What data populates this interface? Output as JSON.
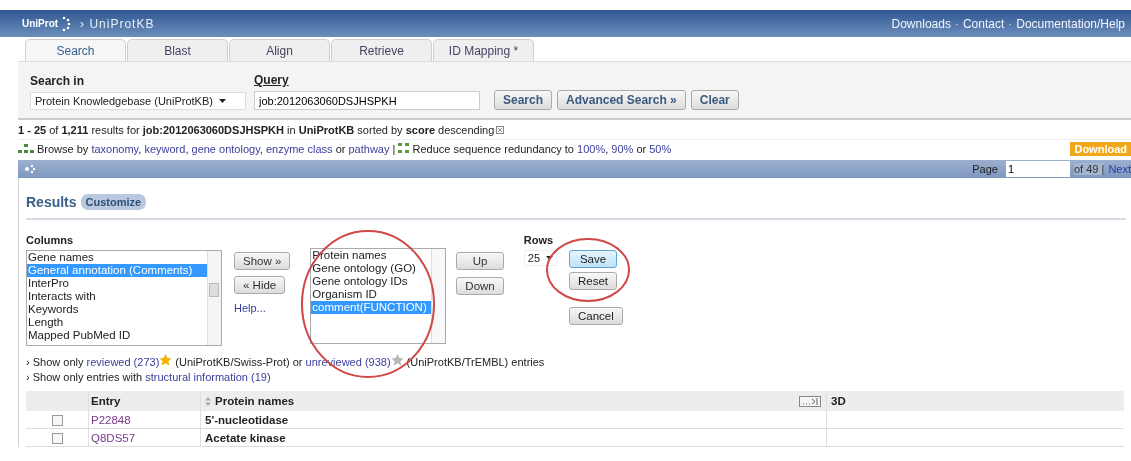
{
  "header": {
    "logo": "UniProt",
    "crumb": "› UniProtKB",
    "links": [
      {
        "kind": "link",
        "label": "Downloads"
      },
      {
        "kind": "sep",
        "label": "·"
      },
      {
        "kind": "link",
        "label": "Contact"
      },
      {
        "kind": "sep",
        "label": "·"
      },
      {
        "kind": "link",
        "label": "Documentation/Help"
      }
    ]
  },
  "tabs": [
    {
      "label": "Search",
      "selected": true
    },
    {
      "label": "Blast",
      "selected": false
    },
    {
      "label": "Align",
      "selected": false
    },
    {
      "label": "Retrieve",
      "selected": false
    },
    {
      "label": "ID Mapping *",
      "selected": false
    }
  ],
  "search": {
    "search_in_label": "Search in",
    "database": "Protein Knowledgebase (UniProtKB)",
    "query_label": "Query",
    "query": "job:2012063060DSJHSPKH",
    "buttons": [
      "Search",
      "Advanced Search »",
      "Clear"
    ]
  },
  "summary": "**1 - 25** of **1,211** results for **job:2012063060DSJHSPKH** in **UniProtKB** sorted by **score** descending",
  "browse": [
    {
      "kind": "text",
      "text": "Browse by "
    },
    {
      "kind": "link",
      "text": "taxonomy"
    },
    {
      "kind": "text",
      "text": ", "
    },
    {
      "kind": "link",
      "text": "keyword"
    },
    {
      "kind": "text",
      "text": ", "
    },
    {
      "kind": "link",
      "text": "gene ontology"
    },
    {
      "kind": "text",
      "text": ", "
    },
    {
      "kind": "link",
      "text": "enzyme class"
    },
    {
      "kind": "text",
      "text": " or "
    },
    {
      "kind": "link",
      "text": "pathway"
    },
    {
      "kind": "text",
      "text": " | "
    },
    {
      "kind": "icon"
    },
    {
      "kind": "text",
      "text": " Reduce sequence redundancy to "
    },
    {
      "kind": "link",
      "text": "100%"
    },
    {
      "kind": "text",
      "text": ", "
    },
    {
      "kind": "link",
      "text": "90%"
    },
    {
      "kind": "text",
      "text": " or "
    },
    {
      "kind": "link",
      "text": "50%"
    }
  ],
  "download": "Download",
  "pager": {
    "label": "Page",
    "value": "1",
    "total": "of 49 |",
    "next": "Next"
  },
  "results": {
    "title": "Results",
    "customize": "Customize",
    "columns_label": "Columns",
    "available": [
      {
        "label": "Gene names",
        "selected": false
      },
      {
        "label": "General annotation (Comments)",
        "selected": true
      },
      {
        "label": "InterPro",
        "selected": false
      },
      {
        "label": "Interacts with",
        "selected": false
      },
      {
        "label": "Keywords",
        "selected": false
      },
      {
        "label": "Length",
        "selected": false
      },
      {
        "label": "Mapped PubMed ID",
        "selected": false
      }
    ],
    "show_button": "Show »",
    "hide_button": "« Hide",
    "help": "Help...",
    "chosen": [
      {
        "label": "Protein names",
        "selected": false
      },
      {
        "label": "Gene ontology (GO)",
        "selected": false
      },
      {
        "label": "Gene ontology IDs",
        "selected": false
      },
      {
        "label": "Organism ID",
        "selected": false
      },
      {
        "label": "comment(FUNCTION)",
        "selected": true
      }
    ],
    "up_button": "Up",
    "down_button": "Down",
    "rows_label": "Rows",
    "rows_value": "25",
    "actions": [
      {
        "label": "Save",
        "kind": "primary"
      },
      {
        "label": "Reset",
        "kind": "normal"
      },
      {
        "label": "Cancel",
        "kind": "normal"
      }
    ]
  },
  "filters": [
    {
      "bullet": "›",
      "parts": [
        {
          "kind": "text",
          "text": "Show only "
        },
        {
          "kind": "link",
          "text": "reviewed (273)"
        },
        {
          "kind": "star",
          "color": "#f0b400"
        },
        {
          "kind": "text",
          "text": " (UniProtKB/Swiss-Prot) or "
        },
        {
          "kind": "link",
          "text": "unreviewed (938)"
        },
        {
          "kind": "star",
          "color": "#b8b8b8"
        },
        {
          "kind": "text",
          "text": " (UniProtKB/TrEMBL) entries"
        }
      ]
    },
    {
      "bullet": "›",
      "parts": [
        {
          "kind": "text",
          "text": "Show only entries with "
        },
        {
          "kind": "link",
          "text": "structural information (19)"
        }
      ]
    }
  ],
  "table": {
    "columns": [
      "Entry",
      "Protein names",
      "3D"
    ],
    "rows": [
      {
        "checked": false,
        "entry": "P22848",
        "name": "5'-nucleotidase"
      },
      {
        "checked": false,
        "entry": "Q8DS57",
        "name": "Acetate kinase"
      }
    ]
  }
}
